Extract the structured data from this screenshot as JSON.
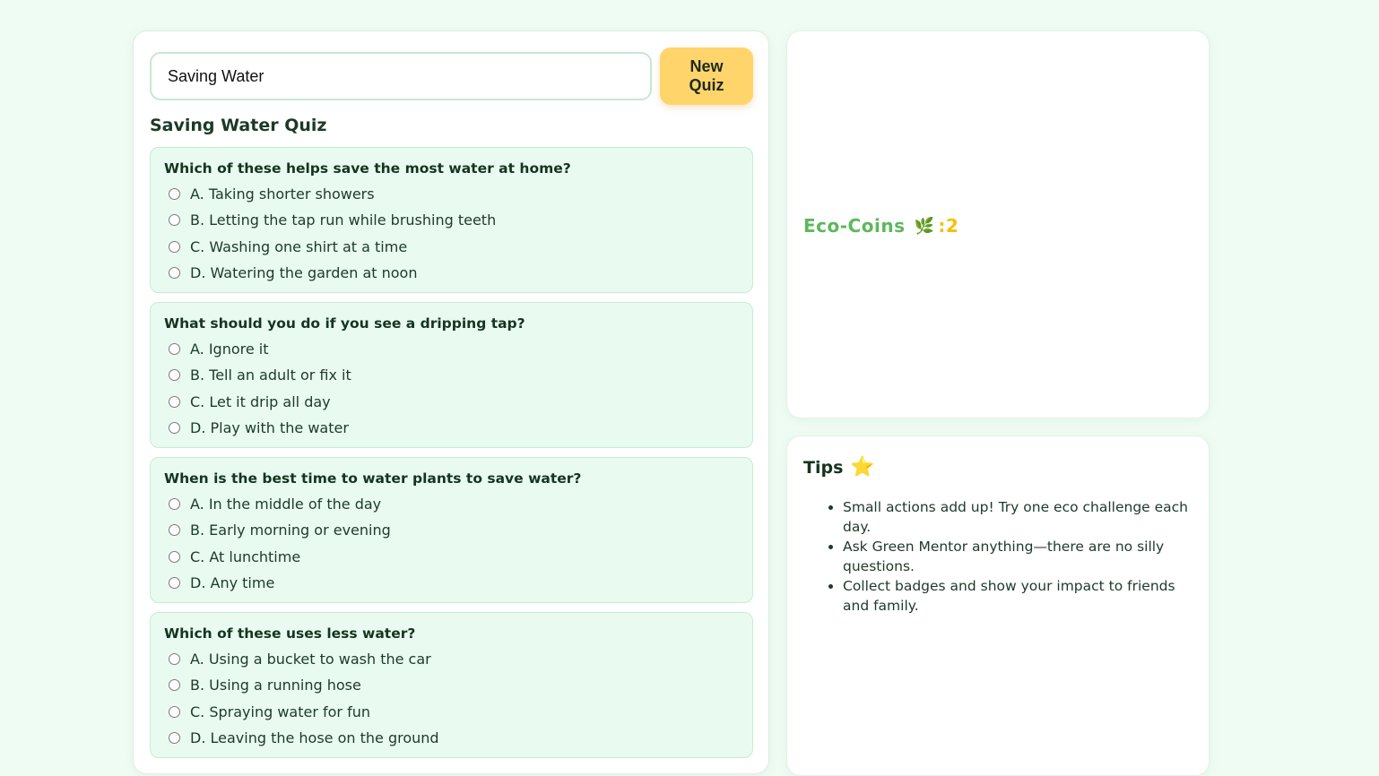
{
  "quiz": {
    "topic_value": "Saving Water",
    "new_quiz_label": "New\nQuiz",
    "title": "Saving Water Quiz",
    "questions": [
      {
        "text": "Which of these helps save the most water at home?",
        "options": [
          "A. Taking shorter showers",
          "B. Letting the tap run while brushing teeth",
          "C. Washing one shirt at a time",
          "D. Watering the garden at noon"
        ]
      },
      {
        "text": "What should you do if you see a dripping tap?",
        "options": [
          "A. Ignore it",
          "B. Tell an adult or fix it",
          "C. Let it drip all day",
          "D. Play with the water"
        ]
      },
      {
        "text": "When is the best time to water plants to save water?",
        "options": [
          "A. In the middle of the day",
          "B. Early morning or evening",
          "C. At lunchtime",
          "D. Any time"
        ]
      },
      {
        "text": "Which of these uses less water?",
        "options": [
          "A. Using a bucket to wash the car",
          "B. Using a running hose",
          "C. Spraying water for fun",
          "D. Leaving the hose on the ground"
        ]
      }
    ]
  },
  "coins": {
    "label": "Eco-Coins",
    "icon": "leaf-icon",
    "separator": ":",
    "count": "2"
  },
  "tips": {
    "title": "Tips",
    "icon": "star-icon",
    "items": [
      "Small actions add up! Try one eco challenge each day.",
      "Ask Green Mentor anything—there are no silly questions.",
      "Collect badges and show your impact to friends and family."
    ]
  },
  "colors": {
    "accent_green": "#5cb85c",
    "coin_gold": "#f5c000",
    "button_yellow": "#ffd56b",
    "question_bg": "#e9fbf0"
  }
}
